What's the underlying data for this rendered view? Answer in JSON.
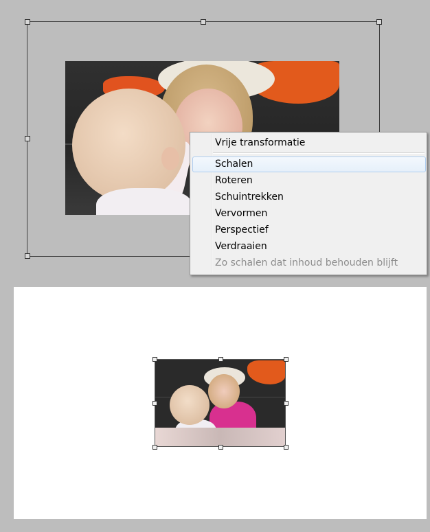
{
  "context_menu": {
    "items": [
      {
        "label": "Vrije transformatie",
        "state": "normal"
      },
      {
        "label": "Schalen",
        "state": "highlighted"
      },
      {
        "label": "Roteren",
        "state": "normal"
      },
      {
        "label": "Schuintrekken",
        "state": "normal"
      },
      {
        "label": "Vervormen",
        "state": "normal"
      },
      {
        "label": "Perspectief",
        "state": "normal"
      },
      {
        "label": "Verdraaien",
        "state": "normal"
      },
      {
        "label": "Zo schalen dat inhoud behouden blijft",
        "state": "disabled"
      }
    ]
  },
  "colors": {
    "workspace_bg": "#bdbdbd",
    "canvas_bg": "#ffffff",
    "menu_bg": "#f0f0f0",
    "menu_highlight_border": "#aeccee",
    "disabled_text": "#8d8d8d"
  }
}
